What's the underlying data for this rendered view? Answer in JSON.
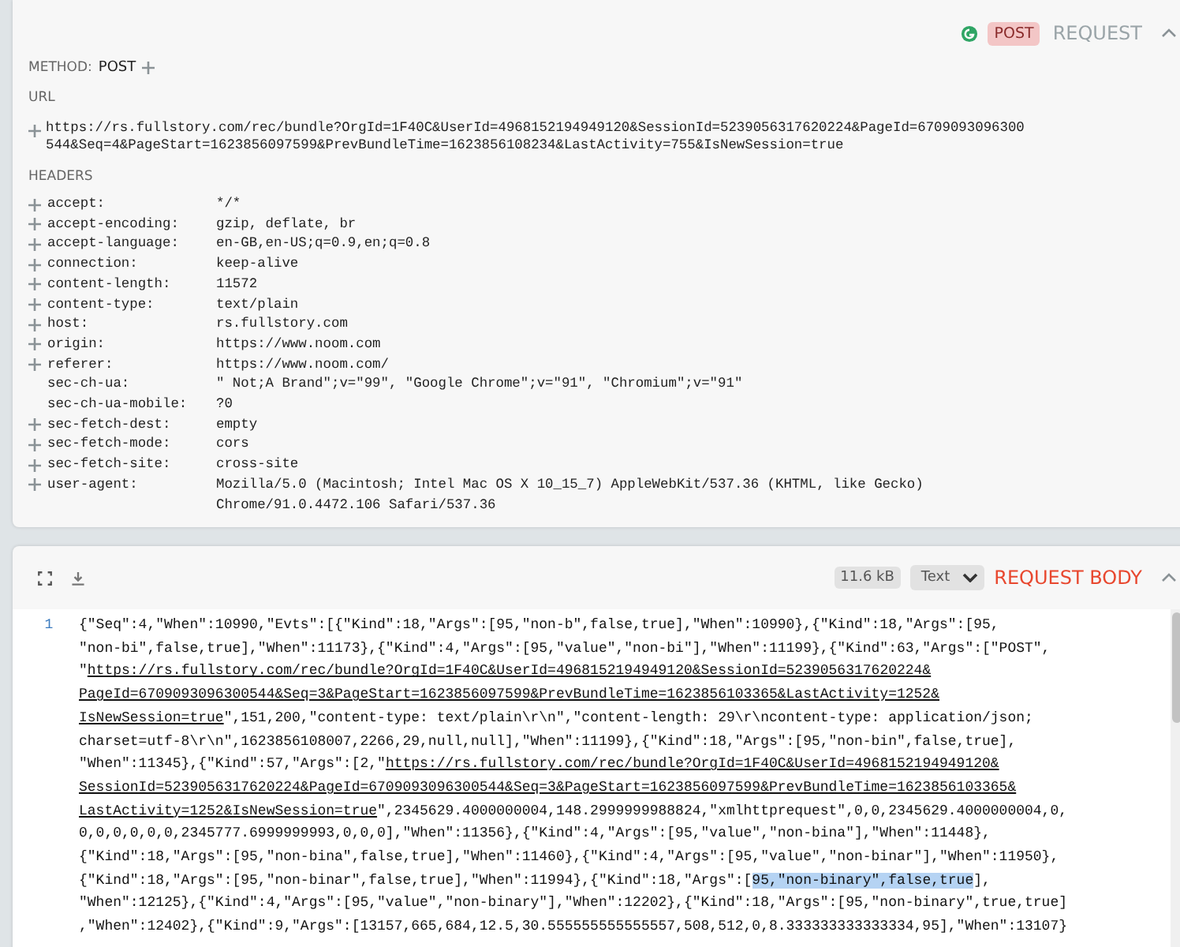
{
  "request": {
    "method_badge": "POST",
    "title": "REQUEST",
    "expanded": true,
    "method_label": "METHOD:",
    "method": "POST",
    "url_label": "URL",
    "url_lines": [
      "https://rs.fullstory.com/rec/bundle?OrgId=1F40C&UserId=4968152194949120&SessionId=5239056317620224&PageId=6709093096300",
      "544&Seq=4&PageStart=1623856097599&PrevBundleTime=1623856108234&LastActivity=755&IsNewSession=true"
    ],
    "headers_label": "HEADERS",
    "headers": [
      {
        "name": "accept:",
        "value_lines": [
          "*/*"
        ],
        "addable": true
      },
      {
        "name": "accept-encoding:",
        "value_lines": [
          "gzip, deflate, br"
        ],
        "addable": true
      },
      {
        "name": "accept-language:",
        "value_lines": [
          "en-GB,en-US;q=0.9,en;q=0.8"
        ],
        "addable": true
      },
      {
        "name": "connection:",
        "value_lines": [
          "keep-alive"
        ],
        "addable": true
      },
      {
        "name": "content-length:",
        "value_lines": [
          "11572"
        ],
        "addable": true
      },
      {
        "name": "content-type:",
        "value_lines": [
          "text/plain"
        ],
        "addable": true
      },
      {
        "name": "host:",
        "value_lines": [
          "rs.fullstory.com"
        ],
        "addable": true
      },
      {
        "name": "origin:",
        "value_lines": [
          "https://www.noom.com"
        ],
        "addable": true
      },
      {
        "name": "referer:",
        "value_lines": [
          "https://www.noom.com/"
        ],
        "addable": true
      },
      {
        "name": "sec-ch-ua:",
        "value_lines": [
          "\" Not;A Brand\";v=\"99\", \"Google Chrome\";v=\"91\", \"Chromium\";v=\"91\""
        ],
        "addable": false
      },
      {
        "name": "sec-ch-ua-mobile:",
        "value_lines": [
          "?0"
        ],
        "addable": false
      },
      {
        "name": "sec-fetch-dest:",
        "value_lines": [
          "empty"
        ],
        "addable": true
      },
      {
        "name": "sec-fetch-mode:",
        "value_lines": [
          "cors"
        ],
        "addable": true
      },
      {
        "name": "sec-fetch-site:",
        "value_lines": [
          "cross-site"
        ],
        "addable": true
      },
      {
        "name": "user-agent:",
        "value_lines": [
          "Mozilla/5.0 (Macintosh; Intel Mac OS X 10_15_7) AppleWebKit/537.36 (KHTML, like Gecko)",
          "Chrome/91.0.4472.106 Safari/537.36"
        ],
        "addable": true
      }
    ]
  },
  "body": {
    "size": "11.6 kB",
    "format": "Text",
    "title": "REQUEST BODY",
    "expanded": true,
    "line_number": "1",
    "lines": [
      [
        {
          "kind": "text",
          "text": "{\"Seq\":4,\"When\":10990,\"Evts\":[{\"Kind\":18,\"Args\":[95,\"non-b\",false,true],\"When\":10990},{\"Kind\":18,\"Args\":[95,"
        }
      ],
      [
        {
          "kind": "text",
          "text": "\"non-bi\",false,true],\"When\":11173},{\"Kind\":4,\"Args\":[95,\"value\",\"non-bi\"],\"When\":11199},{\"Kind\":63,\"Args\":[\"POST\","
        }
      ],
      [
        {
          "kind": "text",
          "text": "\""
        },
        {
          "kind": "link",
          "text": "https://rs.fullstory.com/rec/bundle?OrgId=1F40C&UserId=4968152194949120&SessionId=5239056317620224&"
        }
      ],
      [
        {
          "kind": "link",
          "text": "PageId=6709093096300544&Seq=3&PageStart=1623856097599&PrevBundleTime=1623856103365&LastActivity=1252&"
        }
      ],
      [
        {
          "kind": "link",
          "text": "IsNewSession=true"
        },
        {
          "kind": "text",
          "text": "\",151,200,\"content-type: text/plain\\r\\n\",\"content-length: 29\\r\\ncontent-type: application/json;"
        }
      ],
      [
        {
          "kind": "text",
          "text": "charset=utf-8\\r\\n\",1623856108007,2266,29,null,null],\"When\":11199},{\"Kind\":18,\"Args\":[95,\"non-bin\",false,true],"
        }
      ],
      [
        {
          "kind": "text",
          "text": "\"When\":11345},{\"Kind\":57,\"Args\":[2,\""
        },
        {
          "kind": "link",
          "text": "https://rs.fullstory.com/rec/bundle?OrgId=1F40C&UserId=4968152194949120&"
        }
      ],
      [
        {
          "kind": "link",
          "text": "SessionId=5239056317620224&PageId=6709093096300544&Seq=3&PageStart=1623856097599&PrevBundleTime=1623856103365&"
        }
      ],
      [
        {
          "kind": "link",
          "text": "LastActivity=1252&IsNewSession=true"
        },
        {
          "kind": "text",
          "text": "\",2345629.4000000004,148.2999999988824,\"xmlhttprequest\",0,0,2345629.4000000004,0,"
        }
      ],
      [
        {
          "kind": "text",
          "text": "0,0,0,0,0,0,2345777.6999999993,0,0,0],\"When\":11356},{\"Kind\":4,\"Args\":[95,\"value\",\"non-bina\"],\"When\":11448},"
        }
      ],
      [
        {
          "kind": "text",
          "text": "{\"Kind\":18,\"Args\":[95,\"non-bina\",false,true],\"When\":11460},{\"Kind\":4,\"Args\":[95,\"value\",\"non-binar\"],\"When\":11950},"
        }
      ],
      [
        {
          "kind": "text",
          "text": "{\"Kind\":18,\"Args\":[95,\"non-binar\",false,true],\"When\":11994},{\"Kind\":18,\"Args\":["
        },
        {
          "kind": "selected",
          "text": "95,\"non-binary\",false,true"
        },
        {
          "kind": "text",
          "text": "],"
        }
      ],
      [
        {
          "kind": "text",
          "text": "\"When\":12125},{\"Kind\":4,\"Args\":[95,\"value\",\"non-binary\"],\"When\":12202},{\"Kind\":18,\"Args\":[95,\"non-binary\",true,true]"
        }
      ],
      [
        {
          "kind": "text",
          "text": ",\"When\":12402},{\"Kind\":9,\"Args\":[13157,665,684,12.5,30.555555555555557,508,512,0,8.333333333333334,95],\"When\":13107}"
        }
      ]
    ]
  }
}
